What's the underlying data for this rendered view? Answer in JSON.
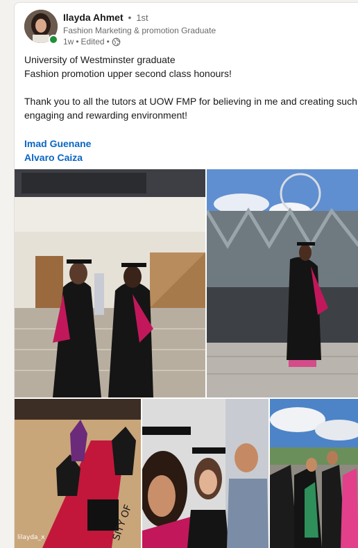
{
  "post": {
    "author_name": "Ilayda Ahmet",
    "separator": "•",
    "connection_degree": "1st",
    "headline": "Fashion Marketing & promotion Graduate",
    "time_ago": "1w",
    "edited": "Edited",
    "visibility_icon": "globe-icon",
    "body_lines": [
      "University of Westminster graduate",
      "Fashion promotion upper second class honours!",
      "Thank you to all the tutors at UOW FMP for believing in me and creating such",
      "engaging and rewarding environment!"
    ],
    "mentions": [
      "Imad Guenane",
      "Alvaro Caiza"
    ],
    "photo_sticker": "lilayda_x"
  },
  "colors": {
    "link": "#0a66c2",
    "online": "#1f8f3a",
    "gown_hood": "#c2185b"
  }
}
